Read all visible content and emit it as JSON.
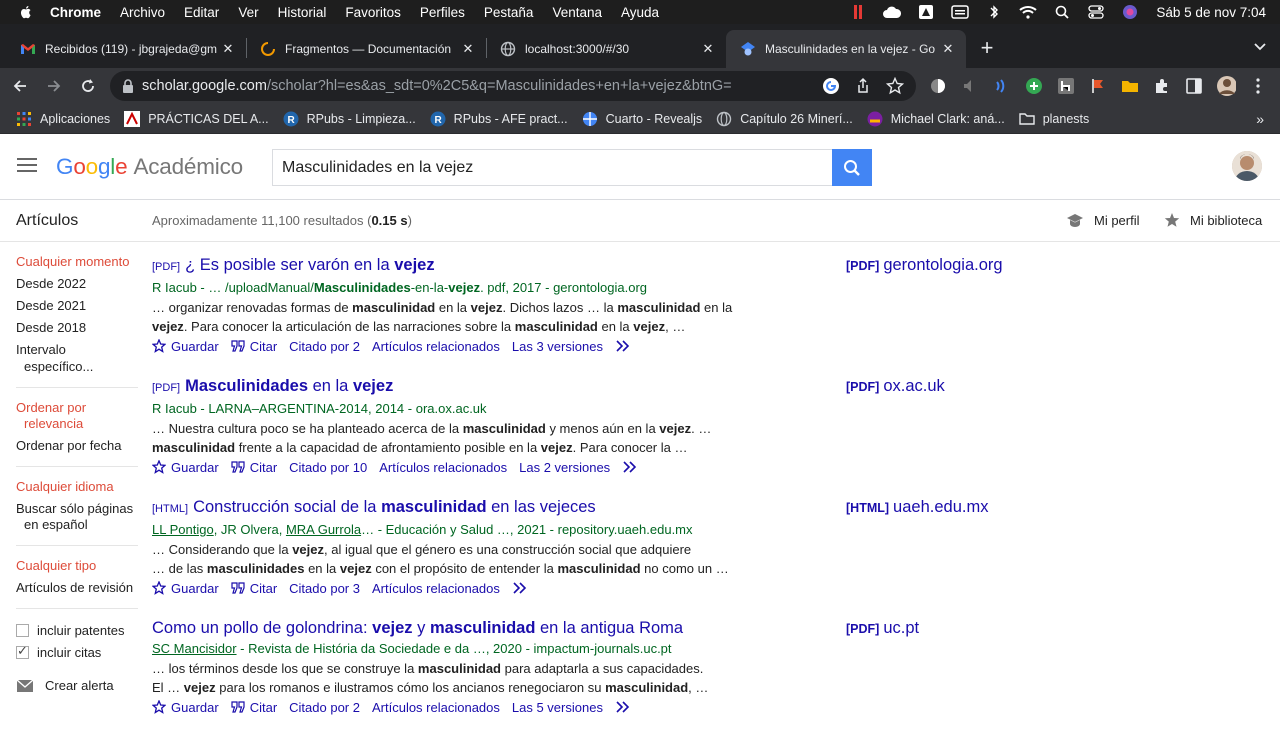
{
  "menubar": {
    "items": [
      "Chrome",
      "Archivo",
      "Editar",
      "Ver",
      "Historial",
      "Favoritos",
      "Perfiles",
      "Pestaña",
      "Ventana",
      "Ayuda"
    ],
    "clock": "Sáb 5 de nov  7:04"
  },
  "tabs": [
    {
      "title": "Recibidos (119) - jbgrajeda@gm",
      "icon": "gmail-icon"
    },
    {
      "title": "Fragmentos — Documentación",
      "icon": "loading-icon"
    },
    {
      "title": "localhost:3000/#/30",
      "icon": "globe-icon"
    },
    {
      "title": "Masculinidades en la vejez - Go",
      "icon": "scholar-icon",
      "active": true
    }
  ],
  "toolbar": {
    "url_host": "scholar.google.com",
    "url_path": "/scholar?hl=es&as_sdt=0%2C5&q=Masculinidades+en+la+vejez&btnG="
  },
  "bookmarks": [
    {
      "label": "Aplicaciones",
      "icon": "apps-grid-icon"
    },
    {
      "label": "PRÁCTICAS DEL A...",
      "icon": "bookmark-favicon"
    },
    {
      "label": "RPubs - Limpieza...",
      "icon": "rpubs-icon"
    },
    {
      "label": "RPubs - AFE pract...",
      "icon": "rpubs-icon"
    },
    {
      "label": "Cuarto - Revealjs",
      "icon": "globe-icon"
    },
    {
      "label": "Capítulo 26 Minerí...",
      "icon": "globe-icon"
    },
    {
      "label": "Michael Clark: aná...",
      "icon": "bookmark-favicon"
    },
    {
      "label": "planests",
      "icon": "folder-icon"
    }
  ],
  "scholar": {
    "logo_google": "Google",
    "logo_product": "Académico",
    "search_value": "Masculinidades en la vejez",
    "section": "Artículos",
    "results_prefix": "Aproximadamente 11,100 resultados (",
    "results_time": "0.15 s",
    "results_suffix": ")",
    "my_profile": "Mi perfil",
    "my_library": "Mi biblioteca"
  },
  "sidebar": {
    "time": [
      "Cualquier momento",
      "Desde 2022",
      "Desde 2021",
      "Desde 2018",
      "Intervalo",
      "específico..."
    ],
    "sort": [
      "Ordenar por",
      "relevancia",
      "Ordenar por fecha"
    ],
    "language": [
      "Cualquier idioma",
      "Buscar sólo páginas",
      "en español"
    ],
    "type": [
      "Cualquier tipo",
      "Artículos de revisión"
    ],
    "include_patents": "incluir patentes",
    "include_citations": "incluir citas",
    "create_alert": "Crear alerta"
  },
  "results": [
    {
      "tag": "[PDF]",
      "title_parts": [
        "¿ Es posible ser varón en la ",
        "vejez"
      ],
      "authors_html": "R Iacub - … /uploadManual/<b>Masculinidades</b>-en-la-<b>vejez</b>. pdf, 2017 - gerontologia.org",
      "snippet_html": "… organizar renovadas formas de <b>masculinidad</b> en la <b>vejez</b>. Dichos lazos … la <b>masculinidad</b> en la <b>vejez</b>. Para conocer la articulación de las narraciones sobre la <b>masculinidad</b> en la <b>vejez</b>, …",
      "actions": [
        "Guardar",
        "Citar",
        "Citado por 2",
        "Artículos relacionados",
        "Las 3 versiones"
      ],
      "side_tag": "[PDF]",
      "side_domain": "gerontologia.org"
    },
    {
      "tag": "[PDF]",
      "title_parts": [
        "",
        "Masculinidades",
        " en la ",
        "vejez"
      ],
      "authors_html": "R Iacub - LARNA–ARGENTINA-2014, 2014 - ora.ox.ac.uk",
      "snippet_html": "… Nuestra cultura poco se ha planteado acerca de la <b>masculinidad</b> y menos aún en la <b>vejez</b>. …<br><b>masculinidad</b> frente a la capacidad de afrontamiento posible en la <b>vejez</b>. Para conocer la …",
      "actions": [
        "Guardar",
        "Citar",
        "Citado por 10",
        "Artículos relacionados",
        "Las 2 versiones"
      ],
      "side_tag": "[PDF]",
      "side_domain": "ox.ac.uk"
    },
    {
      "tag": "[HTML]",
      "title_parts": [
        "Construcción social de la ",
        "masculinidad",
        " en las vejeces"
      ],
      "authors_html": "<u>LL Pontigo</u>, JR Olvera, <u>MRA Gurrola</u>… - Educación y Salud …, 2021 - repository.uaeh.edu.mx",
      "snippet_html": "… Considerando que la <b>vejez</b>, al igual que el género es una construcción social que adquiere<br>… de las <b>masculinidades</b> en la <b>vejez</b> con el propósito de entender la <b>masculinidad</b> no como un …",
      "actions": [
        "Guardar",
        "Citar",
        "Citado por 3",
        "Artículos relacionados"
      ],
      "side_tag": "[HTML]",
      "side_domain": "uaeh.edu.mx"
    },
    {
      "tag": "",
      "title_parts": [
        "Como un pollo de golondrina: ",
        "vejez",
        " y ",
        "masculinidad",
        " en la antigua Roma"
      ],
      "authors_html": "<u>SC Mancisidor</u> - Revista de História da Sociedade e da …, 2020 - impactum-journals.uc.pt",
      "snippet_html": "… los términos desde los que se construye la <b>masculinidad</b> para adaptarla a sus capacidades.<br>El … <b>vejez</b> para los romanos e ilustramos cómo los ancianos renegociaron su <b>masculinidad</b>, …",
      "actions": [
        "Guardar",
        "Citar",
        "Citado por 2",
        "Artículos relacionados",
        "Las 5 versiones"
      ],
      "side_tag": "[PDF]",
      "side_domain": "uc.pt"
    }
  ],
  "colors": {
    "link": "#1a0dab",
    "green": "#006621",
    "active_filter": "#dd4b39",
    "search_button": "#4285f4"
  }
}
